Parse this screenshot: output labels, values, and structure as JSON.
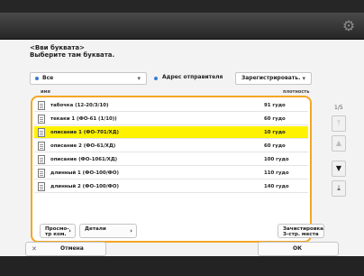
{
  "header": {
    "settings_icon": "gear-icon"
  },
  "page": {
    "title_line1": "<Вви буквата>",
    "title_line2": "Выберите там буквата."
  },
  "filters": {
    "left": {
      "label": "Все"
    },
    "right_label": "Адрес отправителя",
    "right_dropdown": "Зарегистрировать."
  },
  "columns": {
    "name": "имя",
    "size": "плотность"
  },
  "files": [
    {
      "name": "табочка (12-20/3/10)",
      "size": "91 гудо",
      "selected": false
    },
    {
      "name": "текаки 1 (ФО-61 (1/10))",
      "size": "60 гудо",
      "selected": false
    },
    {
      "name": "описание 1 (ФО-701/ХД)",
      "size": "10 гудо",
      "selected": true
    },
    {
      "name": "описание 2 (ФО-61/ХД)",
      "size": "60 гудо",
      "selected": false
    },
    {
      "name": "описание (ФО-1061/ХД)",
      "size": "100 гудо",
      "selected": false
    },
    {
      "name": "длинный 1 (ФО-100/ФО)",
      "size": "110 гудо",
      "selected": false
    },
    {
      "name": "длинный 2 (ФО-100/ФО)",
      "size": "140 гудо",
      "selected": false
    }
  ],
  "pager": {
    "label": "1/5"
  },
  "buttons": {
    "preview": "Просмо-\nтр ком.",
    "details": "Детали",
    "register": "Зачистировка\nЗ-стр. места",
    "cancel": "Отмена",
    "ok": "ОК"
  }
}
